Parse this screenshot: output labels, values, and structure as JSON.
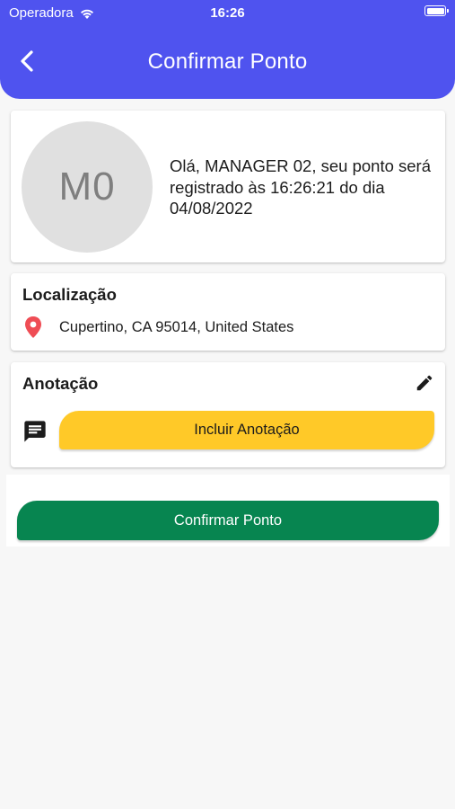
{
  "status_bar": {
    "carrier": "Operadora",
    "time": "16:26"
  },
  "header": {
    "title": "Confirmar Ponto",
    "back_icon": "chevron-left-icon",
    "color": "#4f53ef"
  },
  "user_card": {
    "avatar_initials": "M0",
    "message": "Olá, MANAGER 02, seu ponto será registrado às 16:26:21 do dia 04/08/2022"
  },
  "location_card": {
    "title": "Localização",
    "icon": "map-pin-icon",
    "address": "Cupertino, CA 95014, United States"
  },
  "annotation_card": {
    "title": "Anotação",
    "edit_icon": "pencil-icon",
    "comment_icon": "comment-icon",
    "button_label": "Incluir Anotação",
    "button_color": "#ffc928"
  },
  "confirm": {
    "button_label": "Confirmar Ponto",
    "button_color": "#078550"
  }
}
